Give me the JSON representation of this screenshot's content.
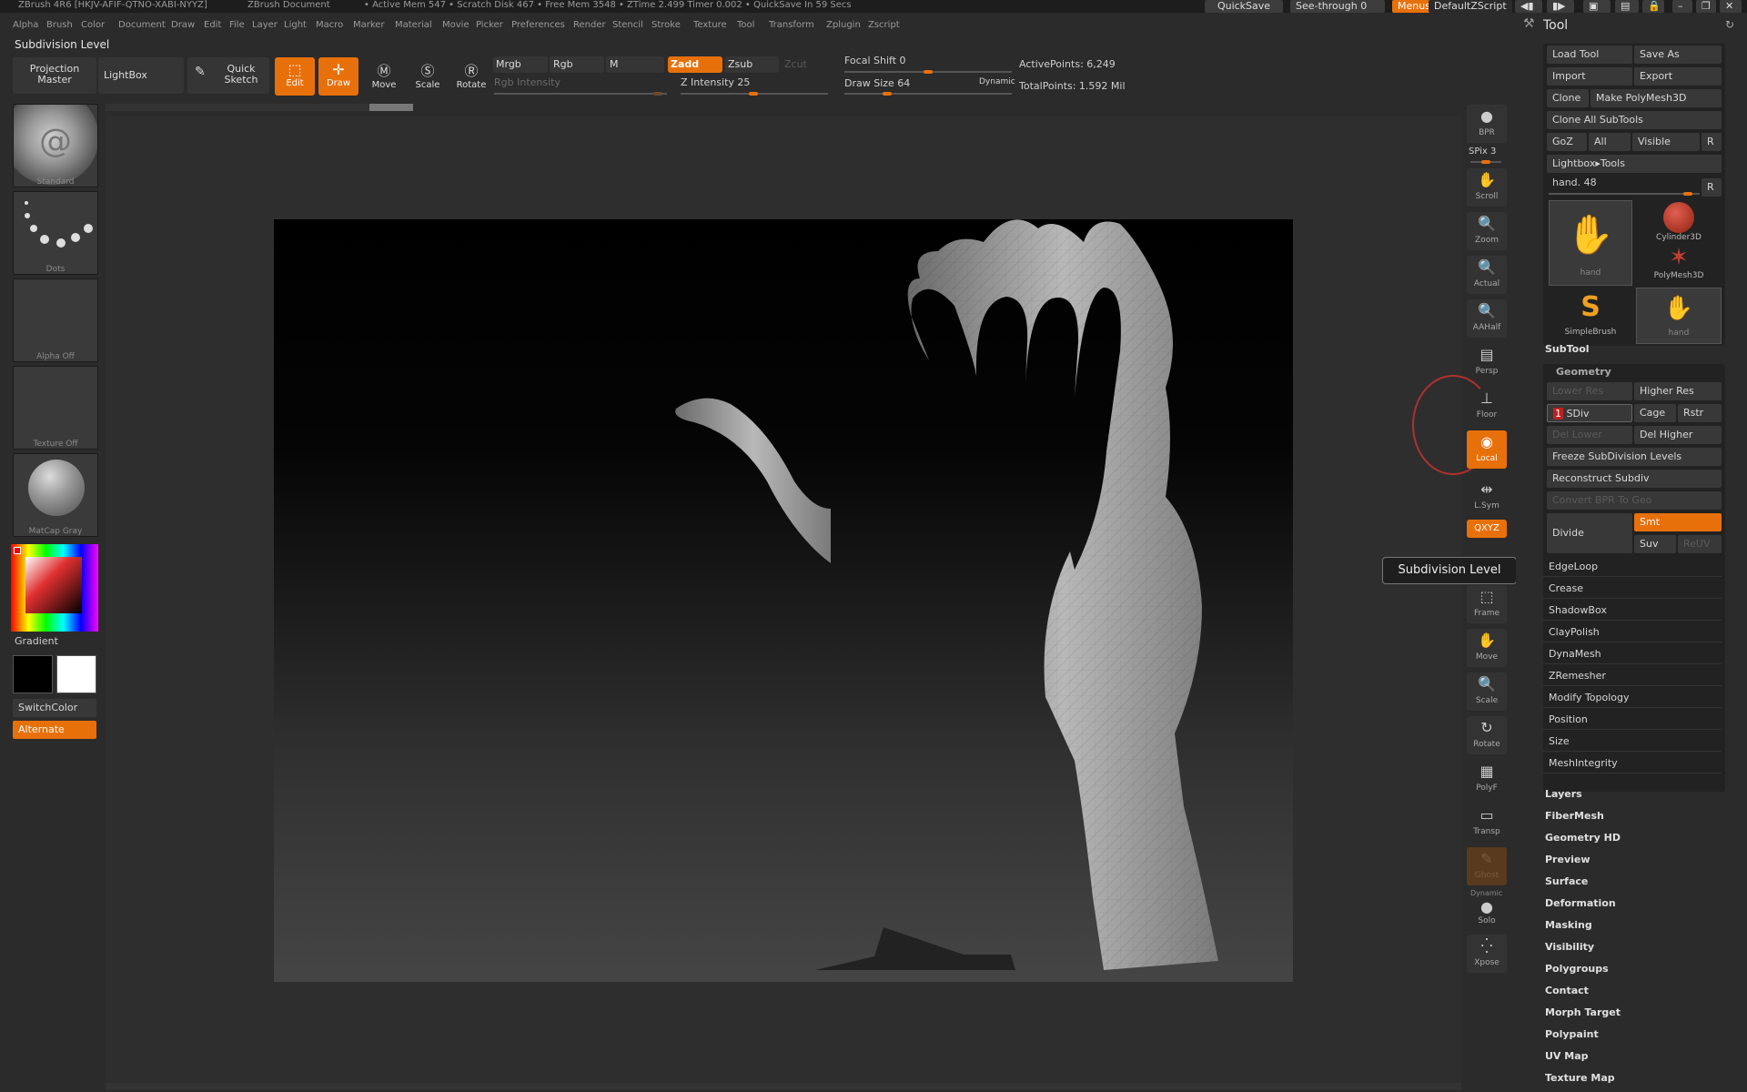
{
  "titlebar": {
    "app": "ZBrush 4R6 [HKJV-AFIF-QTNO-XABI-NYYZ]",
    "doc": "ZBrush Document",
    "stats": "• Active Mem 547 • Scratch Disk 467 • Free Mem 3548 • ZTime 2.499 Timer 0.002 • QuickSave In 59 Secs",
    "quicksave": "QuickSave",
    "see_through": "See-through",
    "see_through_value": "0",
    "menus": "Menus",
    "default_script": "DefaultZScript"
  },
  "menubar": [
    "Alpha",
    "Brush",
    "Color",
    "Document",
    "Draw",
    "Edit",
    "File",
    "Layer",
    "Light",
    "Macro",
    "Marker",
    "Material",
    "Movie",
    "Picker",
    "Preferences",
    "Render",
    "Stencil",
    "Stroke",
    "Texture",
    "Tool",
    "Transform",
    "Zplugin",
    "Zscript"
  ],
  "toolbar": {
    "heading": "Subdivision Level",
    "projection_master": "Projection Master",
    "lightbox": "LightBox",
    "quick_sketch": "Quick Sketch",
    "edit": "Edit",
    "draw": "Draw",
    "move": "Move",
    "scale": "Scale",
    "rotate": "Rotate",
    "mrgb": "Mrgb",
    "rgb": "Rgb",
    "m": "M",
    "zadd": "Zadd",
    "zsub": "Zsub",
    "zcut": "Zcut",
    "rgb_intensity": "Rgb Intensity",
    "z_intensity": "Z Intensity 25",
    "z_intensity_value": 25,
    "focal_shift": "Focal Shift 0",
    "focal_shift_value": 0,
    "draw_size": "Draw Size 64",
    "draw_size_value": 64,
    "dynamic": "Dynamic",
    "active_points": "ActivePoints: 6,249",
    "total_points": "TotalPoints: 1.592 Mil"
  },
  "leftpanel": {
    "brush": "Standard",
    "stroke": "Dots",
    "alpha": "Alpha Off",
    "texture": "Texture Off",
    "material": "MatCap Gray",
    "gradient": "Gradient",
    "switch_color": "SwitchColor",
    "alternate": "Alternate"
  },
  "rightshelf": {
    "bpr": "BPR",
    "spix": "SPix 3",
    "scroll": "Scroll",
    "zoom": "Zoom",
    "actual": "Actual",
    "aahalf": "AAHalf",
    "persp": "Persp",
    "floor": "Floor",
    "local": "Local",
    "lsym": "L.Sym",
    "xyz": "QXYZ",
    "frame": "Frame",
    "move": "Move",
    "scale": "Scale",
    "rotate": "Rotate",
    "polyf": "PolyF",
    "transp": "Transp",
    "ghost": "Ghost",
    "dynamic": "Dynamic",
    "solo": "Solo",
    "xpose": "Xpose"
  },
  "tooltip": "Subdivision Level",
  "toolpanel": {
    "title": "Tool",
    "load_tool": "Load Tool",
    "save_as": "Save As",
    "import": "Import",
    "export": "Export",
    "clone": "Clone",
    "make_polymesh": "Make PolyMesh3D",
    "clone_all": "Clone All SubTools",
    "goz": "GoZ",
    "all": "All",
    "visible": "Visible",
    "r": "R",
    "lightbox_tools": "Lightbox▸Tools",
    "current_tool": "hand. 48",
    "r2": "R",
    "thumbs": [
      "hand",
      "Cylinder3D",
      "PolyMesh3D",
      "SimpleBrush",
      "hand"
    ],
    "subtool": "SubTool",
    "geometry": "Geometry",
    "lower_res": "Lower Res",
    "higher_res": "Higher Res",
    "sdiv": "SDiv",
    "sdiv_value": "1",
    "cage": "Cage",
    "rstr": "Rstr",
    "del_lower": "Del Lower",
    "del_higher": "Del Higher",
    "freeze": "Freeze SubDivision Levels",
    "reconstruct": "Reconstruct Subdiv",
    "convert_bpr": "Convert BPR To Geo",
    "divide": "Divide",
    "smt": "Smt",
    "suv": "Suv",
    "reuv": "ReUV",
    "geo_items": [
      "EdgeLoop",
      "Crease",
      "ShadowBox",
      "ClayPolish",
      "DynaMesh",
      "ZRemesher",
      "Modify Topology",
      "Position",
      "Size",
      "MeshIntegrity"
    ],
    "sections": [
      "Layers",
      "FiberMesh",
      "Geometry HD",
      "Preview",
      "Surface",
      "Deformation",
      "Masking",
      "Visibility",
      "Polygroups",
      "Contact",
      "Morph Target",
      "Polypaint",
      "UV Map",
      "Texture Map"
    ]
  }
}
